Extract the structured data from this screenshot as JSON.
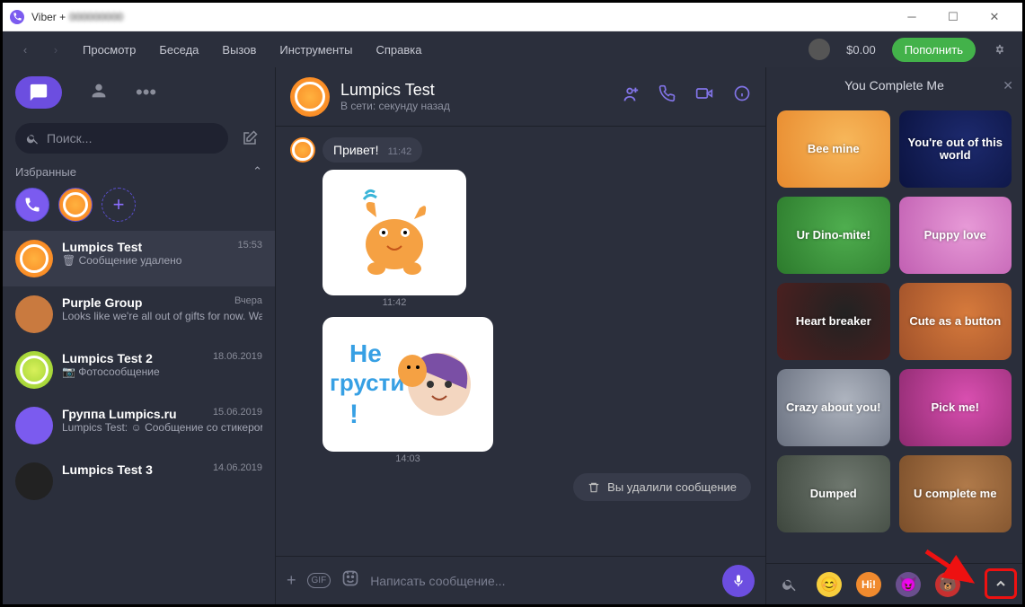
{
  "window": {
    "title_prefix": "Viber +",
    "title_blurred": "000000000"
  },
  "menubar": {
    "items": [
      "Просмотр",
      "Беседа",
      "Вызов",
      "Инструменты",
      "Справка"
    ],
    "balance": "$0.00",
    "topup": "Пополнить"
  },
  "sidebar": {
    "search_placeholder": "Поиск...",
    "section_fav": "Избранные",
    "chats": [
      {
        "name": "Lumpics Test",
        "time": "15:53",
        "sub": "Сообщение удалено",
        "avatar": "orange",
        "selected": true,
        "sub_icon": "trash"
      },
      {
        "name": "Purple Group",
        "time": "Вчера",
        "sub": "Looks like we're all out of gifts for now. Watch this space fo...",
        "avatar": "cookie"
      },
      {
        "name": "Lumpics Test 2",
        "time": "18.06.2019",
        "sub": "Фотосообщение",
        "avatar": "lime",
        "sub_icon": "camera"
      },
      {
        "name": "Группа Lumpics.ru",
        "time": "15.06.2019",
        "sub": "Lumpics Test: ☺ Сообщение со стикером",
        "avatar": "viber"
      },
      {
        "name": "Lumpics Test 3",
        "time": "14.06.2019",
        "sub": "",
        "avatar": "dark"
      }
    ]
  },
  "conversation": {
    "name": "Lumpics Test",
    "status": "В сети: секунду назад",
    "messages": [
      {
        "type": "text",
        "text": "Привет!",
        "time": "11:42"
      },
      {
        "type": "sticker",
        "time": "11:42",
        "label": "cat-wave"
      },
      {
        "type": "sticker",
        "time": "14:03",
        "label": "ne-grusti",
        "caption": "Не грусти !"
      },
      {
        "type": "deleted",
        "text": "Вы удалили сообщение"
      }
    ],
    "composer_placeholder": "Написать сообщение..."
  },
  "sticker_panel": {
    "title": "You Complete Me",
    "items": [
      {
        "label": "Bee mine",
        "c1": "#f7b75a",
        "c2": "#e88a2e"
      },
      {
        "label": "You're out of this world",
        "c1": "#1d2a6e",
        "c2": "#0b1340"
      },
      {
        "label": "Ur Dino-mite!",
        "c1": "#4fae4f",
        "c2": "#2c7a2c"
      },
      {
        "label": "Puppy love",
        "c1": "#e79ad7",
        "c2": "#c15fb2"
      },
      {
        "label": "Heart breaker",
        "c1": "#222",
        "c2": "#4e1f1f"
      },
      {
        "label": "Cute as a button",
        "c1": "#d67a3c",
        "c2": "#a0512a"
      },
      {
        "label": "Crazy about you!",
        "c1": "#aeb4bf",
        "c2": "#6a7180"
      },
      {
        "label": "Pick me!",
        "c1": "#d94fb0",
        "c2": "#8e2a70"
      },
      {
        "label": "Dumped",
        "c1": "#6f786f",
        "c2": "#3d463d"
      },
      {
        "label": "U complete me",
        "c1": "#b07a4a",
        "c2": "#7a4e2a"
      }
    ]
  }
}
